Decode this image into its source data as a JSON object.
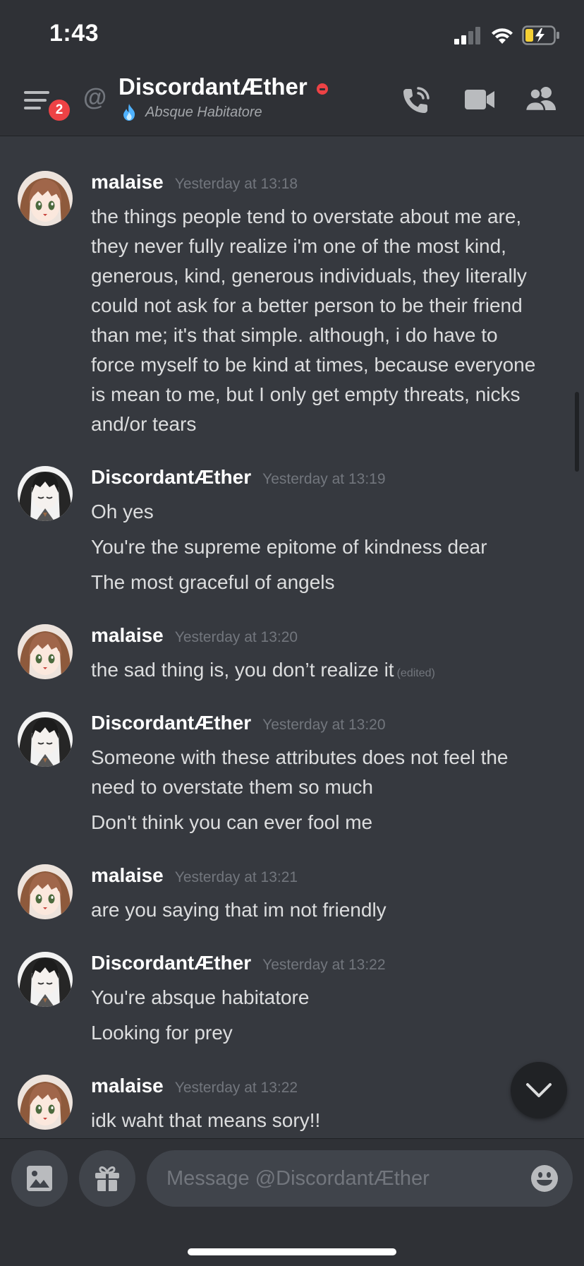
{
  "status_bar": {
    "time": "1:43"
  },
  "header": {
    "menu_badge": "2",
    "title": "DiscordantÆther",
    "subtitle": "Absque Habitatore",
    "icons": [
      "menu-icon",
      "at-icon",
      "call-icon",
      "video-icon",
      "members-icon"
    ]
  },
  "messages": [
    {
      "author": "malaise",
      "avatar": "brown-haired-anime-girl",
      "timestamp": "Yesterday at 13:18",
      "lines": [
        "the things people tend to overstate about me are,",
        "they never fully realize i'm one of the most kind,",
        "generous, kind, generous individuals, they literally",
        "could not ask for a better person to be their friend",
        "than me; it's that simple. although, i do have to",
        "force myself to be kind at times, because everyone",
        "is mean to me, but I only get empty threats, nicks",
        "and/or tears"
      ]
    },
    {
      "author": "DiscordantÆther",
      "avatar": "dark-haired-anime-girl",
      "timestamp": "Yesterday at 13:19",
      "lines": [
        "Oh yes",
        "You're the supreme epitome of kindness dear",
        "The most graceful of angels"
      ]
    },
    {
      "author": "malaise",
      "avatar": "brown-haired-anime-girl",
      "timestamp": "Yesterday at 13:20",
      "lines": [
        "the sad thing is, you don’t realize it"
      ],
      "edited": "(edited)"
    },
    {
      "author": "DiscordantÆther",
      "avatar": "dark-haired-anime-girl",
      "timestamp": "Yesterday at 13:20",
      "lines": [
        "Someone with these attributes does not feel the",
        "need to overstate them so much",
        "Don't think you can ever fool me"
      ]
    },
    {
      "author": "malaise",
      "avatar": "brown-haired-anime-girl",
      "timestamp": "Yesterday at 13:21",
      "lines": [
        "are you saying that im not friendly"
      ]
    },
    {
      "author": "DiscordantÆther",
      "avatar": "dark-haired-anime-girl",
      "timestamp": "Yesterday at 13:22",
      "lines": [
        "You're absque habitatore",
        "Looking for prey"
      ]
    },
    {
      "author": "malaise",
      "avatar": "brown-haired-anime-girl",
      "timestamp": "Yesterday at 13:22",
      "lines": [
        "idk waht that means sory!!"
      ]
    }
  ],
  "composer": {
    "placeholder": "Message @DiscordantÆther",
    "icons": [
      "image-icon",
      "gift-icon",
      "emoji-icon"
    ]
  },
  "colors": {
    "background": "#36393f",
    "header": "#2f3136",
    "dnd": "#ed4245",
    "text": "#dcddde",
    "muted": "#72767d"
  }
}
